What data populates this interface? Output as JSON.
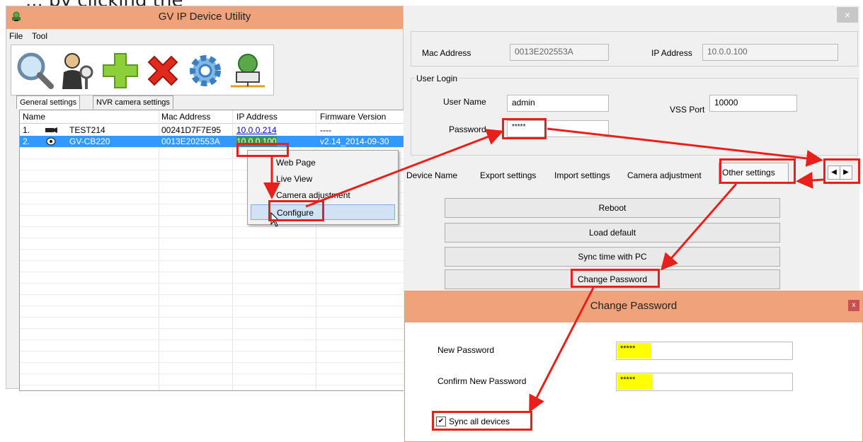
{
  "caption": "... by clicking the",
  "utility": {
    "title": "GV IP Device Utility",
    "menu": [
      "File",
      "Tool"
    ],
    "toolbar_icons": [
      "search-icon",
      "user-key-icon",
      "add-icon",
      "delete-icon",
      "gear-icon",
      "network-device-icon"
    ],
    "tabs": [
      "General settings",
      "NVR camera settings"
    ],
    "columns": [
      "Name",
      "Mac Address",
      "IP Address",
      "Firmware Version"
    ],
    "rows": [
      {
        "num": "1.",
        "name": "TEST214",
        "mac": "00241D7F7E95",
        "ip": "10.0.0.214",
        "firmware": "----"
      },
      {
        "num": "2.",
        "name": "GV-CB220",
        "mac": "0013E202553A",
        "ip": "10.0.0.100",
        "firmware": "v2.14_2014-09-30"
      }
    ]
  },
  "context_menu": [
    "Web Page",
    "Live View",
    "Camera adjustment",
    "Configure"
  ],
  "config": {
    "close": "×",
    "mac_label": "Mac Address",
    "mac_value": "0013E202553A",
    "ip_label": "IP Address",
    "ip_value": "10.0.0.100",
    "login_group": "User Login",
    "username_label": "User Name",
    "username_value": "admin",
    "vss_label": "VSS Port",
    "vss_value": "10000",
    "password_label": "Password",
    "password_value": "*****",
    "tabs": [
      "Device Name",
      "Export settings",
      "Import settings",
      "Camera adjustment",
      "Other settings"
    ],
    "buttons": [
      "Reboot",
      "Load default",
      "Sync time with PC",
      "Change Password"
    ]
  },
  "change_password": {
    "title": "Change Password",
    "close": "x",
    "new_label": "New Password",
    "new_value": "*****",
    "confirm_label": "Confirm New Password",
    "confirm_value": "*****",
    "sync_label": "Sync all devices",
    "sync_checked": true
  },
  "colors": {
    "title_bar": "#f0a27a",
    "selection": "#3399ff",
    "annotation": "#e8201c",
    "highlight": "#ffff00"
  }
}
